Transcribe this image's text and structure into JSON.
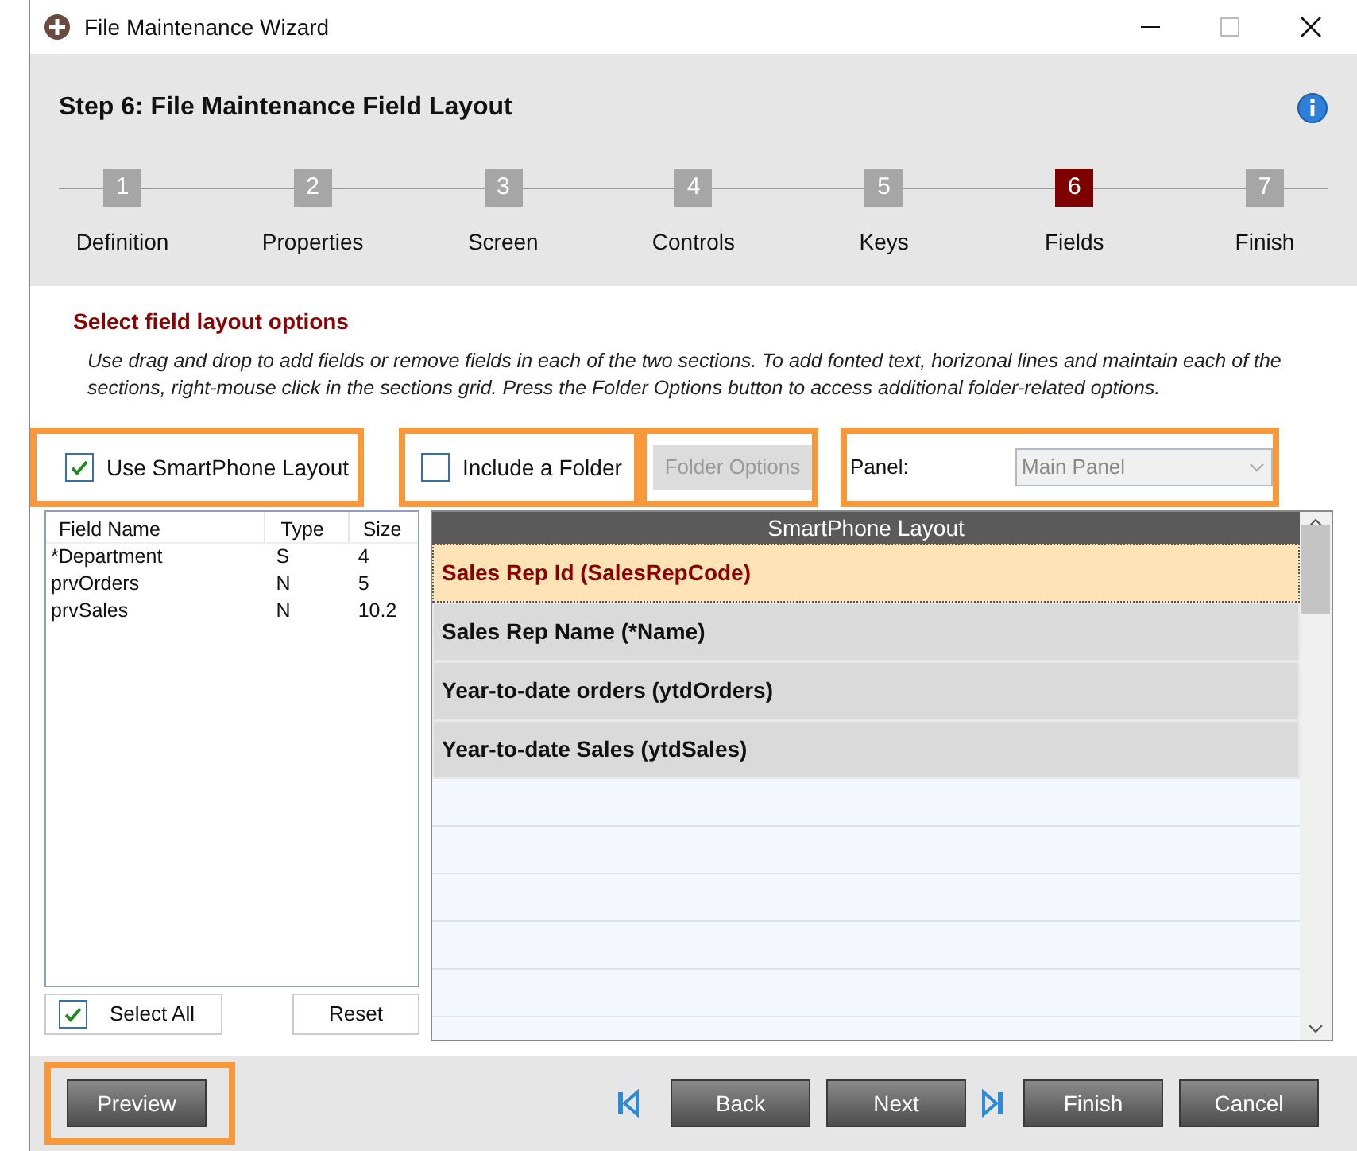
{
  "window": {
    "title": "File Maintenance Wizard"
  },
  "header": {
    "title": "Step 6: File Maintenance Field Layout"
  },
  "steps": [
    {
      "number": "1",
      "label": "Definition",
      "selected": false
    },
    {
      "number": "2",
      "label": "Properties",
      "selected": false
    },
    {
      "number": "3",
      "label": "Screen",
      "selected": false
    },
    {
      "number": "4",
      "label": "Controls",
      "selected": false
    },
    {
      "number": "5",
      "label": "Keys",
      "selected": false
    },
    {
      "number": "6",
      "label": "Fields",
      "selected": true
    },
    {
      "number": "7",
      "label": "Finish",
      "selected": false
    }
  ],
  "section": {
    "title": "Select field layout options",
    "description": "Use drag and drop to add fields or remove fields in each of the two sections.  To add fonted text, horizonal lines and maintain each of the sections, right-mouse click in the sections grid. Press the Folder Options button to access additional folder-related options."
  },
  "options": {
    "smartphone": {
      "label": "Use SmartPhone Layout",
      "checked": true,
      "highlighted": true
    },
    "folder": {
      "label": "Include a Folder",
      "checked": false,
      "highlighted": true
    },
    "folder_options": {
      "label": "Folder Options",
      "disabled": true,
      "highlighted": true
    },
    "panel": {
      "label": "Panel:",
      "value": "Main Panel",
      "disabled": true,
      "highlighted": true
    }
  },
  "field_list": {
    "columns": [
      "Field Name",
      "Type",
      "Size"
    ],
    "rows": [
      [
        "*Department",
        "S",
        "4"
      ],
      [
        "prvOrders",
        "N",
        "5"
      ],
      [
        "prvSales",
        "N",
        "10.2"
      ]
    ]
  },
  "select_all": {
    "label": "Select All",
    "checked": true
  },
  "reset": {
    "label": "Reset"
  },
  "layout_grid": {
    "title": "SmartPhone Layout",
    "rows": [
      {
        "text": "Sales Rep Id (SalesRepCode)",
        "selected": true
      },
      {
        "text": "Sales Rep Name (*Name)",
        "selected": false
      },
      {
        "text": "Year-to-date orders (ytdOrders)",
        "selected": false
      },
      {
        "text": "Year-to-date Sales (ytdSales)",
        "selected": false
      }
    ]
  },
  "footer": {
    "preview": {
      "label": "Preview",
      "highlighted": true
    },
    "back": "Back",
    "next": "Next",
    "finish": "Finish",
    "cancel": "Cancel"
  }
}
